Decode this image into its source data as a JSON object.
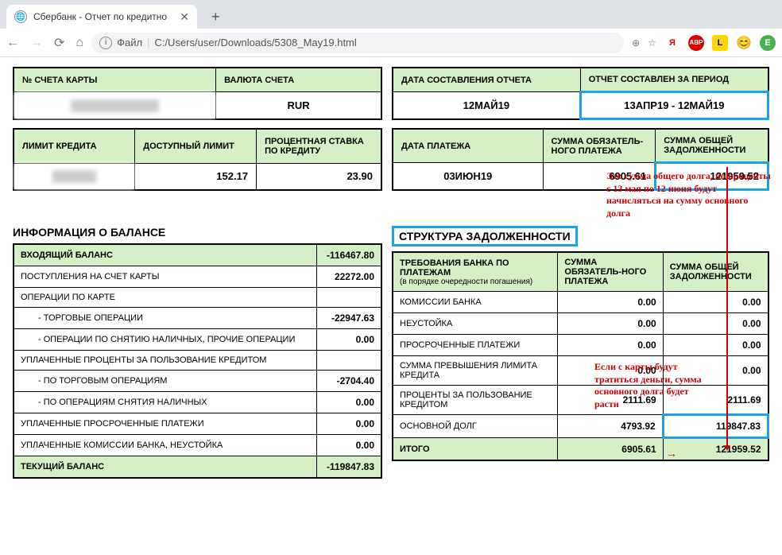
{
  "browser": {
    "tab_title": "Сбербанк - Отчет по кредитно",
    "url_prefix": "Файл",
    "url": "C:/Users/user/Downloads/5308_May19.html",
    "profile_letter": "Е"
  },
  "top1": {
    "h_account": "№ СЧЕТА КАРТЫ",
    "h_currency": "ВАЛЮТА СЧЕТА",
    "v_account": "████████████",
    "v_currency": "RUR"
  },
  "top2": {
    "h_report_date": "ДАТА СОСТАВЛЕНИЯ ОТЧЕТА",
    "h_period": "ОТЧЕТ СОСТАВЛЕН ЗА ПЕРИОД",
    "v_report_date": "12МАЙ19",
    "v_period": "13АПР19 - 12МАЙ19"
  },
  "mid1": {
    "h_limit": "ЛИМИТ КРЕДИТА",
    "h_avail": "ДОСТУПНЫЙ ЛИМИТ",
    "h_rate": "ПРОЦЕНТНАЯ СТАВКА ПО КРЕДИТУ",
    "v_limit": "██████",
    "v_avail": "152.17",
    "v_rate": "23.90"
  },
  "mid2": {
    "h_paydate": "ДАТА ПЛАТЕЖА",
    "h_minpay": "СУММА ОБЯЗАТЕЛЬ-НОГО ПЛАТЕЖА",
    "h_total": "СУММА ОБЩЕЙ ЗАДОЛЖЕННОСТИ",
    "v_paydate": "03ИЮН19",
    "v_minpay": "6905.61",
    "v_total": "121959.52"
  },
  "balance": {
    "title": "ИНФОРМАЦИЯ О БАЛАНСЕ",
    "h_in": "ВХОДЯЩИЙ БАЛАНС",
    "v_in": "-116467.80",
    "rows": [
      {
        "label": "ПОСТУПЛЕНИЯ НА СЧЕТ КАРТЫ",
        "val": "22272.00",
        "indent": false
      },
      {
        "label": "ОПЕРАЦИИ ПО КАРТЕ",
        "val": "",
        "indent": false
      },
      {
        "label": "- ТОРГОВЫЕ ОПЕРАЦИИ",
        "val": "-22947.63",
        "indent": true
      },
      {
        "label": "- ОПЕРАЦИИ ПО СНЯТИЮ НАЛИЧНЫХ, ПРОЧИЕ ОПЕРАЦИИ",
        "val": "0.00",
        "indent": true
      },
      {
        "label": "УПЛАЧЕННЫЕ ПРОЦЕНТЫ ЗА ПОЛЬЗОВАНИЕ КРЕДИТОМ",
        "val": "",
        "indent": false
      },
      {
        "label": "- ПО ТОРГОВЫМ ОПЕРАЦИЯМ",
        "val": "-2704.40",
        "indent": true
      },
      {
        "label": "- ПО ОПЕРАЦИЯМ СНЯТИЯ НАЛИЧНЫХ",
        "val": "0.00",
        "indent": true
      },
      {
        "label": "УПЛАЧЕННЫЕ ПРОСРОЧЕННЫЕ ПЛАТЕЖИ",
        "val": "0.00",
        "indent": false
      },
      {
        "label": "УПЛАЧЕННЫЕ КОМИССИИ БАНКА, НЕУСТОЙКА",
        "val": "0.00",
        "indent": false
      }
    ],
    "h_out": "ТЕКУЩИЙ БАЛАНС",
    "v_out": "-119847.83"
  },
  "debt": {
    "title": "СТРУКТУРА ЗАДОЛЖЕННОСТИ",
    "h_req": "ТРЕБОВАНИЯ БАНКА ПО ПЛАТЕЖАМ",
    "h_req_sub": "(в порядке очередности погашения)",
    "h_minpay": "СУММА ОБЯЗАТЕЛЬ-НОГО ПЛАТЕЖА",
    "h_total": "СУММА ОБЩЕЙ ЗАДОЛЖЕННОСТИ",
    "rows": [
      {
        "label": "КОМИССИИ БАНКА",
        "min": "0.00",
        "tot": "0.00"
      },
      {
        "label": "НЕУСТОЙКА",
        "min": "0.00",
        "tot": "0.00"
      },
      {
        "label": "ПРОСРОЧЕННЫЕ ПЛАТЕЖИ",
        "min": "0.00",
        "tot": "0.00"
      },
      {
        "label": "СУММА ПРЕВЫШЕНИЯ ЛИМИТА КРЕДИТА",
        "min": "0.00",
        "tot": "0.00"
      },
      {
        "label": "ПРОЦЕНТЫ ЗА ПОЛЬЗОВАНИЕ КРЕДИТОМ",
        "min": "2111.69",
        "tot": "2111.69"
      },
      {
        "label": "ОСНОВНОЙ ДОЛГ",
        "min": "4793.92",
        "tot": "119847.83"
      }
    ],
    "h_itogo": "ИТОГО",
    "v_itogo_min": "6905.61",
    "v_itogo_tot": "121959.52"
  },
  "annotations": {
    "a1": "Это сумма общего долга, но проценты с 13 мая по 12 июня будут начисляться на сумму основного долга",
    "a2": "Если с карты будут тратиться деньги, сумма основного долга будет расти"
  }
}
